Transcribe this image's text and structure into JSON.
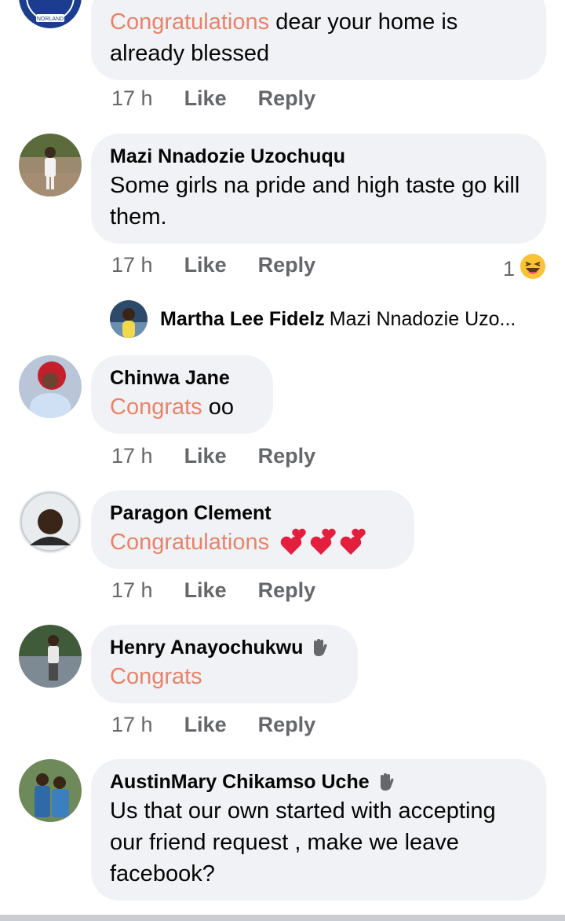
{
  "comments": [
    {
      "name": "",
      "text_highlight": "Congratulations",
      "text_rest": " dear your home is already blessed",
      "time": "17 h"
    },
    {
      "name": "Mazi Nnadozie Uzochuqu",
      "text": "Some girls na pride and high taste go kill them.",
      "time": "17 h",
      "reaction_count": "1"
    },
    {
      "name": "Chinwa Jane",
      "text_highlight": "Congrats",
      "text_rest": " oo",
      "time": "17 h"
    },
    {
      "name": "Paragon Clement",
      "text_highlight": "Congratulations",
      "text_rest": "",
      "time": "17 h"
    },
    {
      "name": "Henry Anayochukwu",
      "text_highlight": "Congrats",
      "time": "17 h"
    },
    {
      "name": "AustinMary Chikamso Uche",
      "text": "Us that our own started with accepting our friend request , make we leave facebook?"
    }
  ],
  "reply_preview": {
    "name": "Martha Lee Fidelz",
    "text": "Mazi Nnadozie Uzo..."
  },
  "actions": {
    "like": "Like",
    "reply": "Reply"
  },
  "logo_text": "NORLAND",
  "colors": {
    "bubble": "#f0f2f5",
    "highlight": "#e8836a",
    "meta": "#65676b"
  }
}
